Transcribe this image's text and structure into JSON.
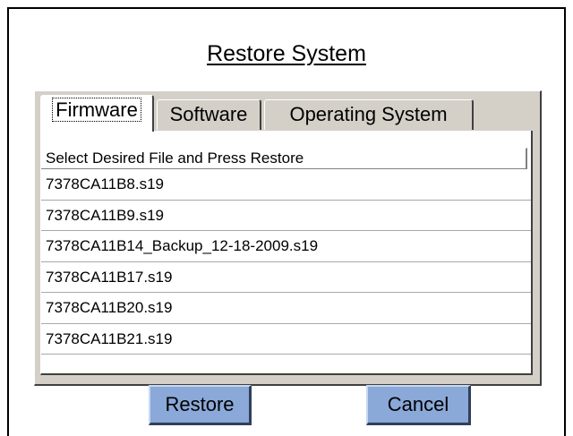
{
  "dialog": {
    "title": "Restore System"
  },
  "tabs": [
    {
      "label": "Firmware",
      "active": true
    },
    {
      "label": "Software",
      "active": false
    },
    {
      "label": "Operating System",
      "active": false
    }
  ],
  "list": {
    "header": "Select Desired File and Press Restore",
    "items": [
      "7378CA11B8.s19",
      "7378CA11B9.s19",
      "7378CA11B14_Backup_12-18-2009.s19",
      "7378CA11B17.s19",
      "7378CA11B20.s19",
      "7378CA11B21.s19"
    ]
  },
  "buttons": {
    "restore_label": "Restore",
    "cancel_label": "Cancel"
  },
  "colors": {
    "button_bg": "#8aa8d8",
    "panel_bg": "#d4d0c8"
  }
}
